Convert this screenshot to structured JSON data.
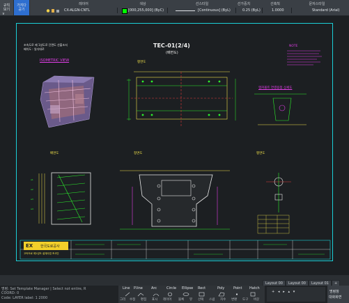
{
  "topbar": {
    "btn1": [
      "규칙",
      "보기"
    ],
    "btn2": [
      "가지다",
      "공기"
    ],
    "headers": [
      "레이어",
      "색상",
      "선스타일",
      "선가중치",
      "선축척",
      "문자스타일"
    ],
    "layer_name": "CX-ALGN-CNTL",
    "color_value": "[000,255,000] (ByC)",
    "linetype": "[Continuous] (ByL)",
    "lineweight": "0.25 (ByL)",
    "linescale": "1.0000",
    "textstyle": "Standard (Arial)"
  },
  "drawing": {
    "title": "TEC-01(2/4)",
    "subtitle": "(배면도)",
    "note_left_1": "조속도로 제 1성도로 단면도 산출조서",
    "note_left_2": "배치도 : 일다대로",
    "iso_label": "ISOMETRIC VIEW",
    "plan_label": "평면도",
    "front_label": "배면도",
    "side_label": "측면도",
    "section_label": "정면도",
    "detail_label": "앵커볼트 연결용접 상세도",
    "detail2_label": "평면도",
    "notes_label": "NOTE",
    "company": "한국도로공사",
    "company_sub": "고속도로 제1성도 설계사업 조사단"
  },
  "layouts": [
    "Layout 00",
    "Layout 00",
    "Layout 01",
    "+"
  ],
  "command": {
    "line1": "명령: Set Template Manager | Select not entire, R",
    "line2": "COORD: 0",
    "line3": "Code: LAYER  label: 1 2000"
  },
  "drawbar": {
    "tools": [
      "Line",
      "P.line",
      "Arc",
      "Circle",
      "Ellipse",
      "Rect",
      "Poly",
      "Point",
      "Hatch"
    ],
    "subtools": [
      "그리",
      "수정",
      "편집",
      "표시",
      "레이어",
      "블록",
      "뷰",
      "선택",
      "스냅",
      "치수",
      "변환",
      "도구",
      "바꾼"
    ]
  },
  "rightpanel": [
    "명령창",
    "대화화면"
  ],
  "colors": {
    "frame": "#1ad0d8",
    "green": "#2cf22c",
    "magenta": "#e23ee8",
    "yellow": "#f2e24a",
    "red": "#e23a3a"
  }
}
